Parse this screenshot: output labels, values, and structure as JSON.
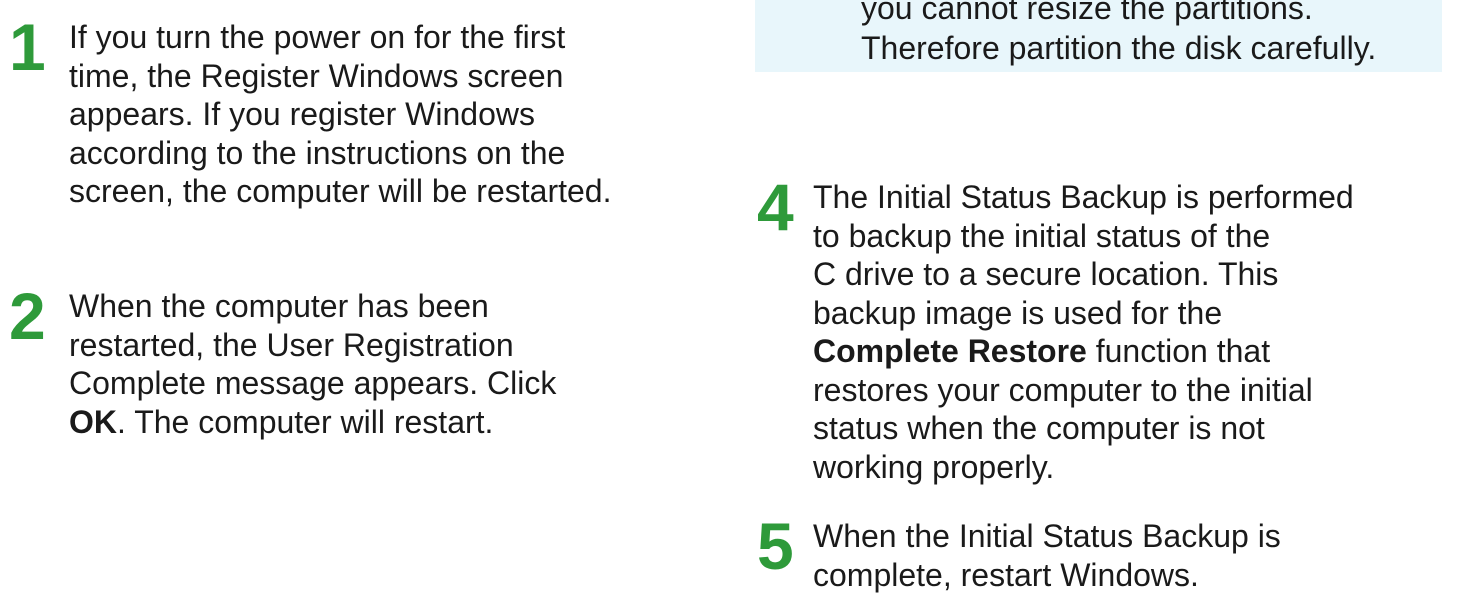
{
  "note": {
    "lines": [
      "you cannot resize the partitions.",
      "Therefore partition the disk carefully."
    ]
  },
  "steps": [
    {
      "number": "1",
      "lines": [
        "If you turn the power on for the first",
        "time, the Register Windows screen",
        "appears. If you register Windows",
        "according to the instructions on the",
        "screen, the computer will be restarted."
      ]
    },
    {
      "number": "2",
      "lines": [
        "When the computer has been",
        "restarted, the User Registration",
        "Complete message appears. Click"
      ],
      "last_bold": "OK",
      "last_rest": ". The computer will restart."
    },
    {
      "number": "4",
      "lines_before": [
        "The Initial Status Backup is performed",
        "to backup the initial status of the",
        "C drive to a secure location. This",
        "backup image is used for the"
      ],
      "bold": "Complete Restore",
      "bold_rest": " function that",
      "lines_after": [
        "restores your computer to the initial",
        "status when the computer is not",
        "working properly."
      ]
    },
    {
      "number": "5",
      "lines": [
        "When the Initial Status Backup is",
        "complete, restart Windows."
      ]
    }
  ],
  "colors": {
    "step_number": "#2e9a3a",
    "note_background": "#e8f6fb"
  }
}
